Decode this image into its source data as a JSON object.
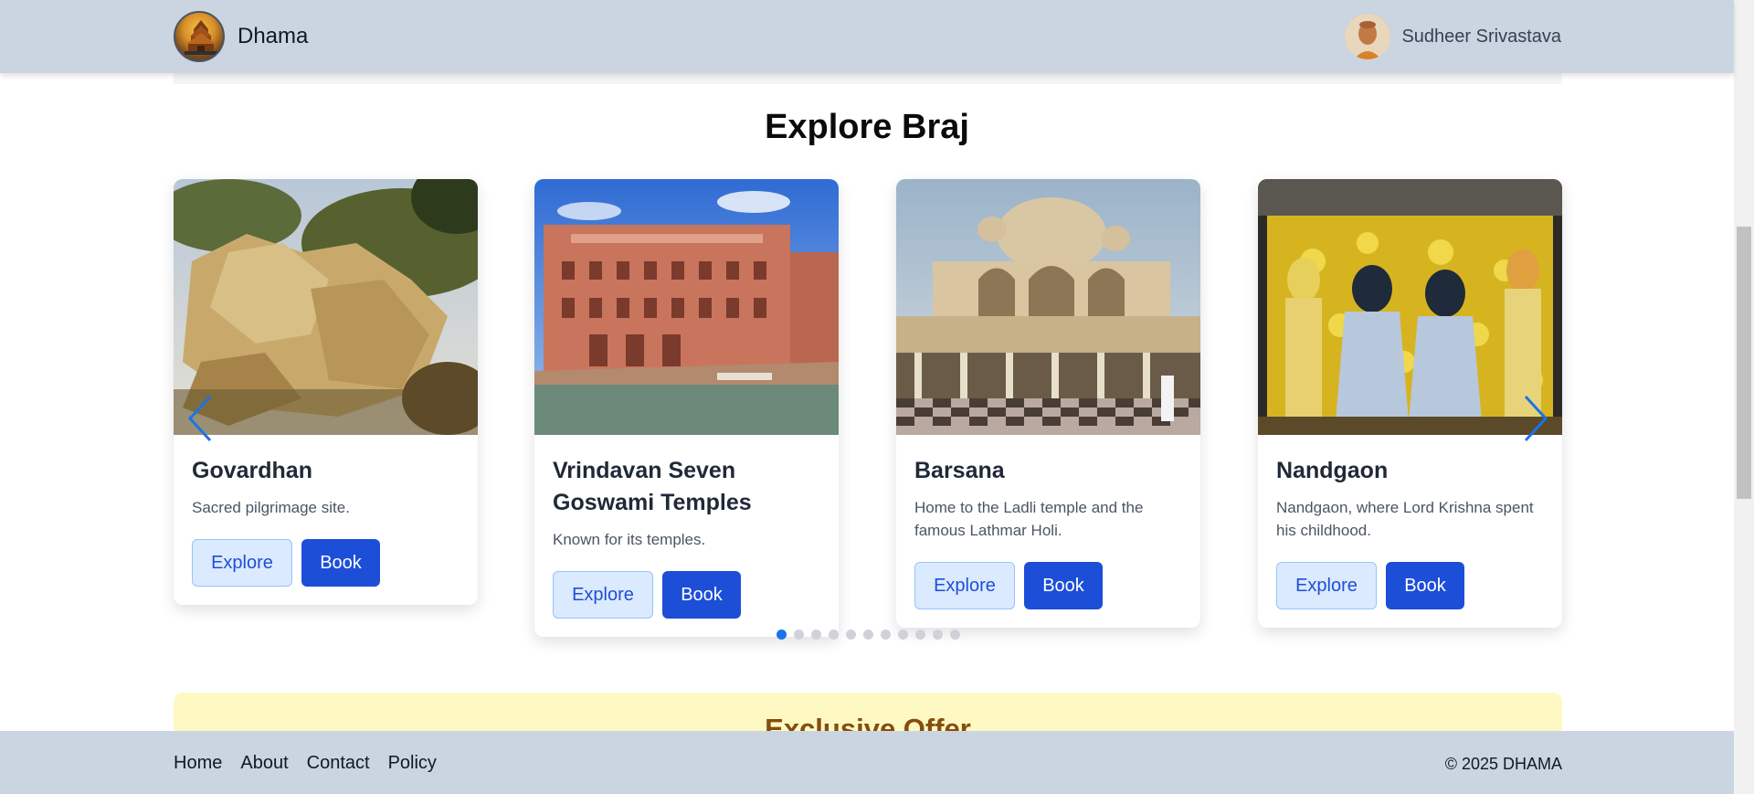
{
  "header": {
    "brand_name": "Dhama",
    "logo_icon": "temple-logo-icon",
    "user_name": "Sudheer Srivastava",
    "avatar_icon": "user-avatar"
  },
  "section": {
    "title": "Explore Braj"
  },
  "carousel": {
    "cards": [
      {
        "title": "Govardhan",
        "description": "Sacred pilgrimage site.",
        "explore_label": "Explore",
        "book_label": "Book",
        "image": "rocky-hill-photo"
      },
      {
        "title": "Vrindavan Seven Goswami Temples",
        "description": "Known for its temples.",
        "explore_label": "Explore",
        "book_label": "Book",
        "image": "ghat-palace-photo"
      },
      {
        "title": "Barsana",
        "description": "Home to the Ladli temple and the famous Lathmar Holi.",
        "explore_label": "Explore",
        "book_label": "Book",
        "image": "temple-courtyard-photo"
      },
      {
        "title": "Nandgaon",
        "description": "Nandgaon, where Lord Krishna spent his childhood.",
        "explore_label": "Explore",
        "book_label": "Book",
        "image": "deity-shrine-photo"
      }
    ],
    "prev_icon": "chevron-left-icon",
    "next_icon": "chevron-right-icon",
    "dot_count": 11,
    "active_dot": 0,
    "accent_color": "#1a73e8"
  },
  "offer": {
    "title": "Exclusive Offer"
  },
  "footer": {
    "links": [
      "Home",
      "About",
      "Contact",
      "Policy"
    ],
    "copyright": "© 2025 DHAMA"
  },
  "colors": {
    "header_bg": "#cbd5e1",
    "primary": "#1d4ed8",
    "explore_bg": "#dbeafe",
    "offer_bg": "#fef9c3",
    "offer_text": "#854d0e"
  }
}
